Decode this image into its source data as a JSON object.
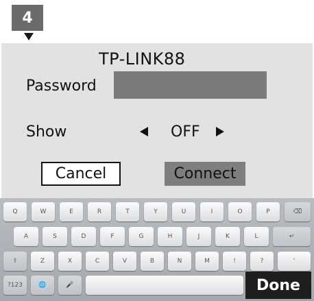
{
  "step": {
    "number": "4"
  },
  "dialog": {
    "ssid": "TP-LINK88",
    "password_label": "Password",
    "password_value": "",
    "show_label": "Show",
    "show_value": "OFF",
    "cancel_label": "Cancel",
    "connect_label": "Connect"
  },
  "keyboard": {
    "row1": [
      "Q",
      "W",
      "E",
      "R",
      "T",
      "Y",
      "U",
      "I",
      "O",
      "P",
      "⌫"
    ],
    "row2": [
      "A",
      "S",
      "D",
      "F",
      "G",
      "H",
      "J",
      "K",
      "L",
      "↵"
    ],
    "row3": [
      "⇧",
      "Z",
      "X",
      "C",
      "V",
      "B",
      "N",
      "M",
      "!",
      "?",
      "'"
    ],
    "row4": [
      "?123",
      "🌐",
      "🎤"
    ],
    "done_label": "Done"
  }
}
